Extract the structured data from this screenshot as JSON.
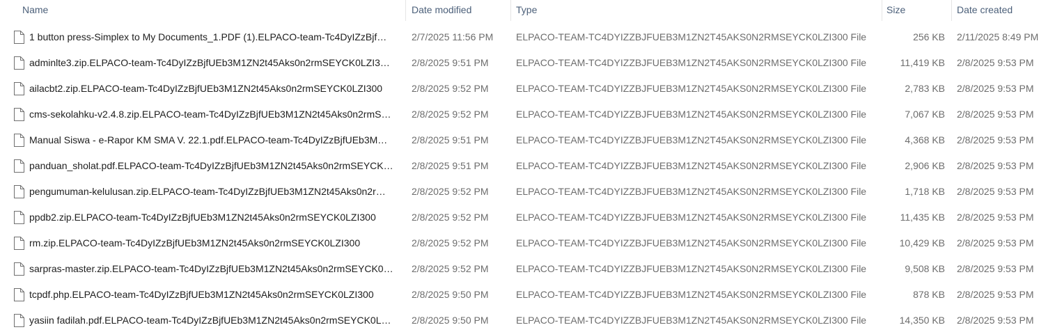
{
  "columns": {
    "name": "Name",
    "date_modified": "Date modified",
    "type": "Type",
    "size": "Size",
    "date_created": "Date created"
  },
  "files": [
    {
      "name": "1 button press-Simplex to My Documents_1.PDF (1).ELPACO-team-Tc4DyIZzBjf…",
      "modified": "2/7/2025 11:56 PM",
      "type": "ELPACO-TEAM-TC4DYIZZBJFUEB3M1ZN2T45AKS0N2RMSEYCK0LZI300 File",
      "size": "256 KB",
      "created": "2/11/2025 8:49 PM",
      "icon": "blank-file-icon"
    },
    {
      "name": "adminlte3.zip.ELPACO-team-Tc4DyIZzBjfUEb3M1ZN2t45Aks0n2rmSEYCK0LZI3…",
      "modified": "2/8/2025 9:51 PM",
      "type": "ELPACO-TEAM-TC4DYIZZBJFUEB3M1ZN2T45AKS0N2RMSEYCK0LZI300 File",
      "size": "11,419 KB",
      "created": "2/8/2025 9:53 PM",
      "icon": "blank-file-icon"
    },
    {
      "name": "ailacbt2.zip.ELPACO-team-Tc4DyIZzBjfUEb3M1ZN2t45Aks0n2rmSEYCK0LZI300",
      "modified": "2/8/2025 9:52 PM",
      "type": "ELPACO-TEAM-TC4DYIZZBJFUEB3M1ZN2T45AKS0N2RMSEYCK0LZI300 File",
      "size": "2,783 KB",
      "created": "2/8/2025 9:53 PM",
      "icon": "blank-file-icon"
    },
    {
      "name": "cms-sekolahku-v2.4.8.zip.ELPACO-team-Tc4DyIZzBjfUEb3M1ZN2t45Aks0n2rmS…",
      "modified": "2/8/2025 9:52 PM",
      "type": "ELPACO-TEAM-TC4DYIZZBJFUEB3M1ZN2T45AKS0N2RMSEYCK0LZI300 File",
      "size": "7,067 KB",
      "created": "2/8/2025 9:53 PM",
      "icon": "blank-file-icon"
    },
    {
      "name": "Manual Siswa - e-Rapor KM SMA V. 22.1.pdf.ELPACO-team-Tc4DyIZzBjfUEb3M…",
      "modified": "2/8/2025 9:51 PM",
      "type": "ELPACO-TEAM-TC4DYIZZBJFUEB3M1ZN2T45AKS0N2RMSEYCK0LZI300 File",
      "size": "4,368 KB",
      "created": "2/8/2025 9:53 PM",
      "icon": "blank-file-icon"
    },
    {
      "name": "panduan_sholat.pdf.ELPACO-team-Tc4DyIZzBjfUEb3M1ZN2t45Aks0n2rmSEYCK…",
      "modified": "2/8/2025 9:51 PM",
      "type": "ELPACO-TEAM-TC4DYIZZBJFUEB3M1ZN2T45AKS0N2RMSEYCK0LZI300 File",
      "size": "2,906 KB",
      "created": "2/8/2025 9:53 PM",
      "icon": "blank-file-icon"
    },
    {
      "name": "pengumuman-kelulusan.zip.ELPACO-team-Tc4DyIZzBjfUEb3M1ZN2t45Aks0n2r…",
      "modified": "2/8/2025 9:52 PM",
      "type": "ELPACO-TEAM-TC4DYIZZBJFUEB3M1ZN2T45AKS0N2RMSEYCK0LZI300 File",
      "size": "1,718 KB",
      "created": "2/8/2025 9:53 PM",
      "icon": "blank-file-icon"
    },
    {
      "name": "ppdb2.zip.ELPACO-team-Tc4DyIZzBjfUEb3M1ZN2t45Aks0n2rmSEYCK0LZI300",
      "modified": "2/8/2025 9:52 PM",
      "type": "ELPACO-TEAM-TC4DYIZZBJFUEB3M1ZN2T45AKS0N2RMSEYCK0LZI300 File",
      "size": "11,435 KB",
      "created": "2/8/2025 9:53 PM",
      "icon": "blank-file-icon"
    },
    {
      "name": "rm.zip.ELPACO-team-Tc4DyIZzBjfUEb3M1ZN2t45Aks0n2rmSEYCK0LZI300",
      "modified": "2/8/2025 9:52 PM",
      "type": "ELPACO-TEAM-TC4DYIZZBJFUEB3M1ZN2T45AKS0N2RMSEYCK0LZI300 File",
      "size": "10,429 KB",
      "created": "2/8/2025 9:53 PM",
      "icon": "blank-file-icon"
    },
    {
      "name": "sarpras-master.zip.ELPACO-team-Tc4DyIZzBjfUEb3M1ZN2t45Aks0n2rmSEYCK0…",
      "modified": "2/8/2025 9:52 PM",
      "type": "ELPACO-TEAM-TC4DYIZZBJFUEB3M1ZN2T45AKS0N2RMSEYCK0LZI300 File",
      "size": "9,508 KB",
      "created": "2/8/2025 9:53 PM",
      "icon": "blank-file-icon"
    },
    {
      "name": "tcpdf.php.ELPACO-team-Tc4DyIZzBjfUEb3M1ZN2t45Aks0n2rmSEYCK0LZI300",
      "modified": "2/8/2025 9:50 PM",
      "type": "ELPACO-TEAM-TC4DYIZZBJFUEB3M1ZN2T45AKS0N2RMSEYCK0LZI300 File",
      "size": "878 KB",
      "created": "2/8/2025 9:53 PM",
      "icon": "blank-file-icon"
    },
    {
      "name": "yasiin fadilah.pdf.ELPACO-team-Tc4DyIZzBjfUEb3M1ZN2t45Aks0n2rmSEYCK0L…",
      "modified": "2/8/2025 9:50 PM",
      "type": "ELPACO-TEAM-TC4DYIZZBJFUEB3M1ZN2T45AKS0N2RMSEYCK0LZI300 File",
      "size": "14,350 KB",
      "created": "2/8/2025 9:53 PM",
      "icon": "blank-file-icon"
    }
  ],
  "colors": {
    "header_text": "#4c607a",
    "secondary_text": "#6d6d6d",
    "separator": "#e5e5e5"
  }
}
